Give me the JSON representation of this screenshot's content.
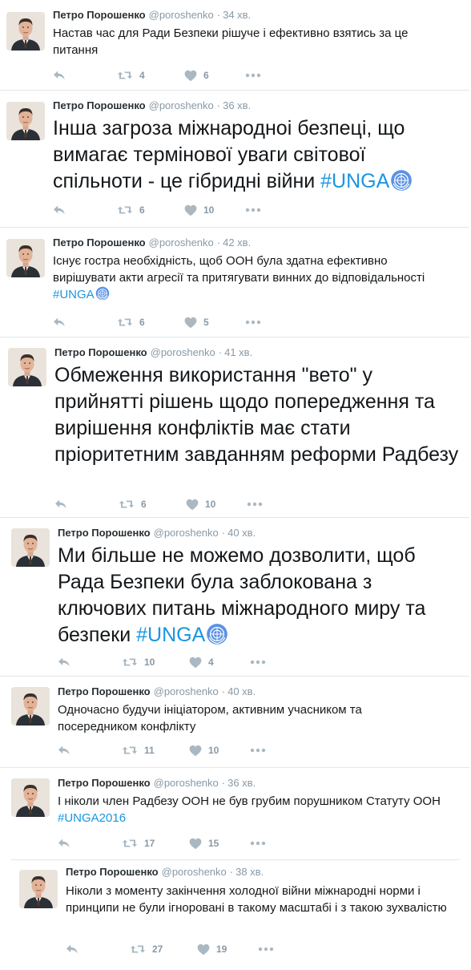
{
  "colors": {
    "accent": "#1b95e0",
    "muted": "#8899a6",
    "icon": "#aab8c2",
    "divider": "#e1e8ed"
  },
  "icons": {
    "reply": "reply-icon",
    "retweet": "retweet-icon",
    "like": "heart-icon",
    "more": "more-dots-icon",
    "un_emblem": "un-emblem-icon"
  },
  "tweets": [
    {
      "name": "Петро Порошенко",
      "handle": "@poroshenko",
      "dot": "·",
      "time": "34 хв.",
      "text_parts": [
        "Настав час для Ради Безпеки рішуче і ефективно взятись за це питання"
      ],
      "retweets": "4",
      "likes": "6"
    },
    {
      "name": "Петро Порошенко",
      "handle": "@poroshenko",
      "dot": "·",
      "time": "36 хв.",
      "text_parts": [
        "Інша загроза міжнародноі безпеці, що вимагає термінової уваги світової спільноти - це гібридні війни "
      ],
      "hashtag": "#UNGA",
      "retweets": "6",
      "likes": "10"
    },
    {
      "name": "Петро Порошенко",
      "handle": "@poroshenko",
      "dot": "·",
      "time": "42 хв.",
      "text_parts": [
        "Існує гостра необхідність, щоб ООН була здатна ефективно вирішувати акти агресії та притягувати винних до відповідальності "
      ],
      "hashtag": "#UNGA",
      "retweets": "6",
      "likes": "5"
    },
    {
      "name": "Петро Порошенко",
      "handle": "@poroshenko",
      "dot": "·",
      "time": "41 хв.",
      "text_parts": [
        "Обмеження використання \"вето\" у прийнятті рішень щодо попередження та вирішення конфліктів має стати пріоритетним завданням реформи Радбезу"
      ],
      "retweets": "6",
      "likes": "10"
    },
    {
      "name": "Петро Порошенко",
      "handle": "@poroshenko",
      "dot": "·",
      "time": "40 хв.",
      "text_parts": [
        "Ми більше не можемо дозволити, щоб Рада Безпеки була заблокована з ключових питань міжнародного миру та безпеки "
      ],
      "hashtag": "#UNGA",
      "retweets": "10",
      "likes": "4"
    },
    {
      "name": "Петро Порошенко",
      "handle": "@poroshenko",
      "dot": "·",
      "time": "40 хв.",
      "text_parts": [
        "Одночасно будучи ініціатором, активним учасником та посередником конфлікту"
      ],
      "retweets": "11",
      "likes": "10"
    },
    {
      "name": "Петро Порошенко",
      "handle": "@poroshenko",
      "dot": "·",
      "time": "36 хв.",
      "text_parts": [
        "І ніколи член Радбезу ООН не був грубим порушником Статуту ООН "
      ],
      "hashtag": "#UNGA2016",
      "retweets": "17",
      "likes": "15"
    },
    {
      "name": "Петро Порошенко",
      "handle": "@poroshenko",
      "dot": "·",
      "time": "38 хв.",
      "text_parts": [
        "Ніколи з моменту закінчення холодної війни міжнародні норми і принципи не були ігноровані в такому масштабі і з такою зухвалістю"
      ],
      "retweets": "27",
      "likes": "19"
    }
  ]
}
